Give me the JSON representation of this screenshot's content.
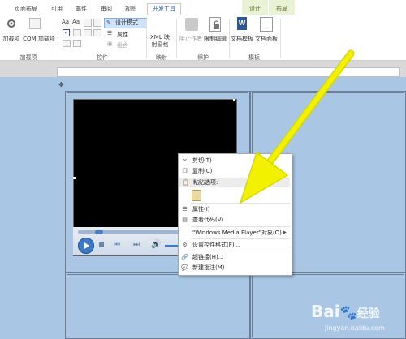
{
  "ribbon": {
    "tabs": [
      "页面布局",
      "引用",
      "邮件",
      "审阅",
      "视图",
      "开发工具"
    ],
    "active_tab": "开发工具",
    "context_tabs": [
      "设计",
      "布局"
    ],
    "buttons": {
      "addins": "加载项",
      "com": "COM 加载项",
      "design_mode": "设计模式",
      "properties": "属性",
      "group": "组合",
      "xml_pane": "XML 映射窗格",
      "block_authors": "阻止作者",
      "restrict_editing": "限制编辑",
      "doc_template": "文档模板",
      "doc_panel": "文档面板"
    },
    "groups": {
      "addins": "加载项",
      "controls": "控件",
      "mapping": "映射",
      "protect": "保护",
      "templates": "模板"
    }
  },
  "context_menu": {
    "items": [
      "剪切(T)",
      "复制(C)",
      "粘贴选项:",
      "属性(I)",
      "查看代码(V)",
      "\"Windows Media Player\"对象(O)",
      "设置控件格式(F)...",
      "超链接(H)...",
      "新建批注(M)"
    ]
  },
  "watermark": {
    "brand": "Bai",
    "brand2": "经验",
    "url": "jingyan.baidu.com"
  },
  "colors": {
    "accent": "#2b579a",
    "doc_bg": "#a9c6e4",
    "arrow": "#f2f200"
  }
}
